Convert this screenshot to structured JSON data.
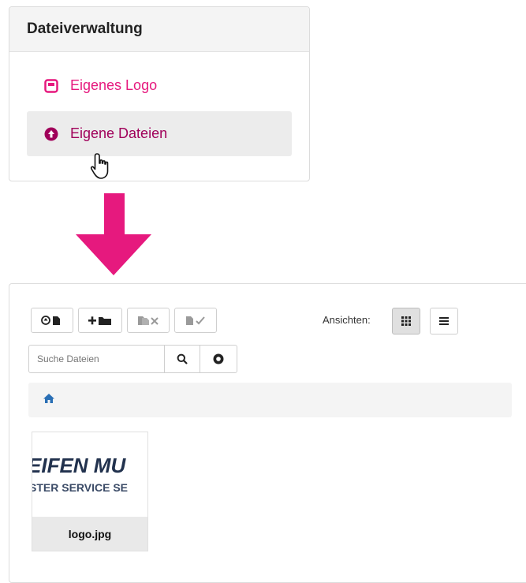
{
  "file_manager": {
    "title": "Dateiverwaltung",
    "items": [
      {
        "label": "Eigenes Logo"
      },
      {
        "label": "Eigene Dateien"
      }
    ]
  },
  "browser": {
    "views_label": "Ansichten:",
    "search": {
      "placeholder": "Suche Dateien"
    },
    "files": [
      {
        "name": "logo.jpg",
        "preview_line1": "EIFEN MU",
        "preview_line2": "STER SERVICE SE"
      }
    ]
  },
  "colors": {
    "accent": "#e6197e",
    "active_text": "#a0005a",
    "link_blue": "#2a6fb5"
  }
}
